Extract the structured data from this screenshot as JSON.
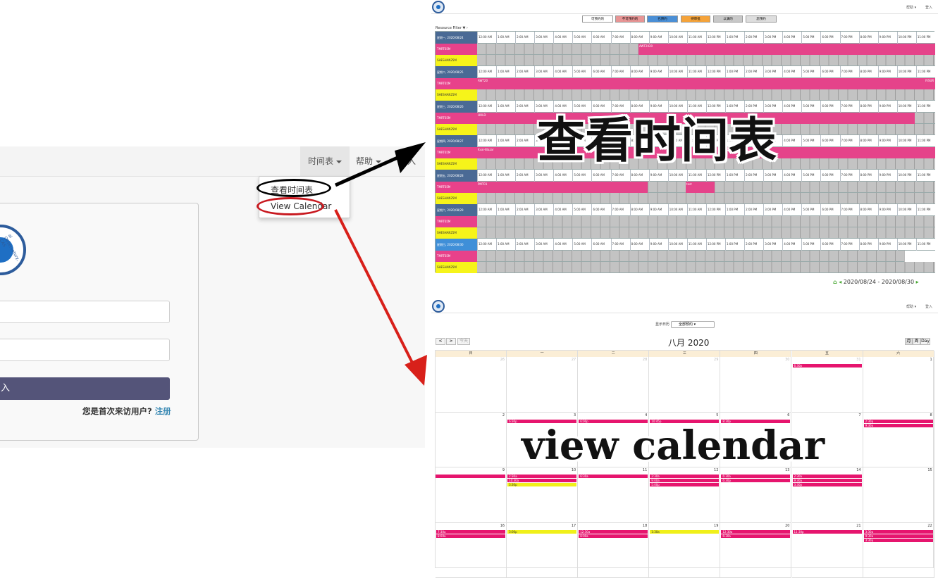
{
  "login_page": {
    "nav": {
      "timetable": "时间表",
      "help": "帮助",
      "login_partial": "入"
    },
    "dropdown": {
      "view_timetable": "查看时间表",
      "view_calendar": "View Calendar"
    },
    "logo_text": "al Observatory, CAS",
    "login_button": "入",
    "first_visit": "您是首次来访用户?",
    "register": "注册"
  },
  "timetable": {
    "top_help": "帮助 ▾",
    "top_login": "登入",
    "legend": [
      "可预约的",
      "不可预约的",
      "已预约",
      "待审批",
      "以满的",
      "您预约"
    ],
    "legend_colors": [
      "#ffffff",
      "#e89595",
      "#4a8fd6",
      "#f5a33a",
      "#c8c8c8",
      "#dedede"
    ],
    "resource_filter": "Resource Filter",
    "times": [
      "12:00 AM",
      "1:00 AM",
      "2:00 AM",
      "3:00 AM",
      "4:00 AM",
      "5:00 AM",
      "6:00 AM",
      "7:00 AM",
      "8:00 AM",
      "9:00 AM",
      "10:00 AM",
      "11:00 AM",
      "12:00 PM",
      "1:00 PM",
      "2:00 PM",
      "3:00 PM",
      "4:00 PM",
      "5:00 PM",
      "6:00 PM",
      "7:00 PM",
      "8:00 PM",
      "9:00 PM",
      "10:00 PM",
      "11:00 PM"
    ],
    "resources": [
      "TMRT65M",
      "SHESHAN25M"
    ],
    "days": [
      "星期一, 2020/08/24",
      "星期二, 2020/08/25",
      "星期三, 2020/08/26",
      "星期四, 2020/08/27",
      "星期五, 2020/08/28",
      "星期六, 2020/08/29",
      "星期日, 2020/08/30"
    ],
    "bookings": [
      {
        "day": 0,
        "label": "AWT2020"
      },
      {
        "day": 1,
        "label": "AWT20",
        "end_label": "IVSUR"
      },
      {
        "day": 2,
        "label": "HOLD"
      },
      {
        "day": 3,
        "label": "Kvar-Blazar"
      },
      {
        "day": 4,
        "label": "PMT01",
        "second_label": "test"
      }
    ],
    "range": "2020/08/24 - 2020/08/30",
    "overlay": "查看时间表"
  },
  "calendar": {
    "top_help": "帮助 ▾",
    "top_login": "登入",
    "filter_label": "显示日历",
    "filter_value": "全部预约",
    "nav": [
      "<",
      ">",
      "今天"
    ],
    "month_title": "八月 2020",
    "views": [
      "月",
      "周",
      "Day"
    ],
    "weekdays": [
      "日",
      "一",
      "二",
      "三",
      "四",
      "五",
      "六"
    ],
    "weeks": [
      [
        "26",
        "27",
        "28",
        "29",
        "30",
        "31",
        "1"
      ],
      [
        "2",
        "3",
        "4",
        "5",
        "6",
        "7",
        "8"
      ],
      [
        "9",
        "10",
        "11",
        "12",
        "13",
        "14",
        "15"
      ],
      [
        "16",
        "17",
        "18",
        "19",
        "20",
        "21",
        "22"
      ]
    ],
    "events": [
      {
        "week": 0,
        "day": 5,
        "row": 0,
        "label": "6:30p",
        "color": "pink"
      },
      {
        "week": 1,
        "day": 1,
        "row": 0,
        "label": "6:30p",
        "color": "pink"
      },
      {
        "week": 1,
        "day": 2,
        "row": 0,
        "label": "6:00p",
        "color": "pink"
      },
      {
        "week": 1,
        "day": 3,
        "row": 0,
        "label": "10:45p",
        "color": "pink"
      },
      {
        "week": 1,
        "day": 4,
        "row": 0,
        "label": "8:30p",
        "color": "pink"
      },
      {
        "week": 1,
        "day": 6,
        "row": 0,
        "label": "2:30p",
        "color": "pink"
      },
      {
        "week": 1,
        "day": 6,
        "row": 1,
        "label": "9:30a",
        "color": "pink"
      },
      {
        "week": 2,
        "day": 0,
        "row": 0,
        "label": "",
        "color": "pink"
      },
      {
        "week": 2,
        "day": 1,
        "row": 0,
        "label": "2:30a",
        "color": "pink"
      },
      {
        "week": 2,
        "day": 1,
        "row": 1,
        "label": "10:30a",
        "color": "pink"
      },
      {
        "week": 2,
        "day": 1,
        "row": 2,
        "label": "3:30p",
        "color": "yellow"
      },
      {
        "week": 2,
        "day": 2,
        "row": 0,
        "label": "6:30a",
        "color": "pink"
      },
      {
        "week": 2,
        "day": 3,
        "row": 0,
        "label": "2:30a",
        "color": "pink"
      },
      {
        "week": 2,
        "day": 3,
        "row": 1,
        "label": "9:00a",
        "color": "pink"
      },
      {
        "week": 2,
        "day": 3,
        "row": 2,
        "label": "5:00p",
        "color": "pink"
      },
      {
        "week": 2,
        "day": 4,
        "row": 0,
        "label": "6:30a",
        "color": "pink"
      },
      {
        "week": 2,
        "day": 4,
        "row": 1,
        "label": "6:30p",
        "color": "pink"
      },
      {
        "week": 2,
        "day": 5,
        "row": 0,
        "label": "2:30a",
        "color": "pink"
      },
      {
        "week": 2,
        "day": 5,
        "row": 1,
        "label": "9:30a",
        "color": "pink"
      },
      {
        "week": 2,
        "day": 5,
        "row": 2,
        "label": "3:30p",
        "color": "pink"
      },
      {
        "week": 3,
        "day": 0,
        "row": 0,
        "label": "7:30a",
        "color": "pink"
      },
      {
        "week": 3,
        "day": 0,
        "row": 1,
        "label": "8:00a",
        "color": "pink"
      },
      {
        "week": 3,
        "day": 1,
        "row": 0,
        "label": "3:00p",
        "color": "yellow"
      },
      {
        "week": 3,
        "day": 2,
        "row": 0,
        "label": "12:30a",
        "color": "pink"
      },
      {
        "week": 3,
        "day": 2,
        "row": 1,
        "label": "8:00a",
        "color": "pink"
      },
      {
        "week": 3,
        "day": 3,
        "row": 0,
        "label": "1:30a",
        "color": "yellow"
      },
      {
        "week": 3,
        "day": 4,
        "row": 0,
        "label": "12:30a",
        "color": "pink"
      },
      {
        "week": 3,
        "day": 4,
        "row": 1,
        "label": "6:30a",
        "color": "pink"
      },
      {
        "week": 3,
        "day": 5,
        "row": 0,
        "label": "11:30p",
        "color": "pink"
      },
      {
        "week": 3,
        "day": 6,
        "row": 0,
        "label": "3:30a",
        "color": "pink"
      },
      {
        "week": 3,
        "day": 6,
        "row": 1,
        "label": "9:30a",
        "color": "pink"
      },
      {
        "week": 3,
        "day": 6,
        "row": 2,
        "label": "3:30p",
        "color": "pink"
      }
    ],
    "overlay": "view calendar"
  },
  "arrow_colors": {
    "to_timetable": "#000000",
    "to_calendar": "#d8201a"
  }
}
